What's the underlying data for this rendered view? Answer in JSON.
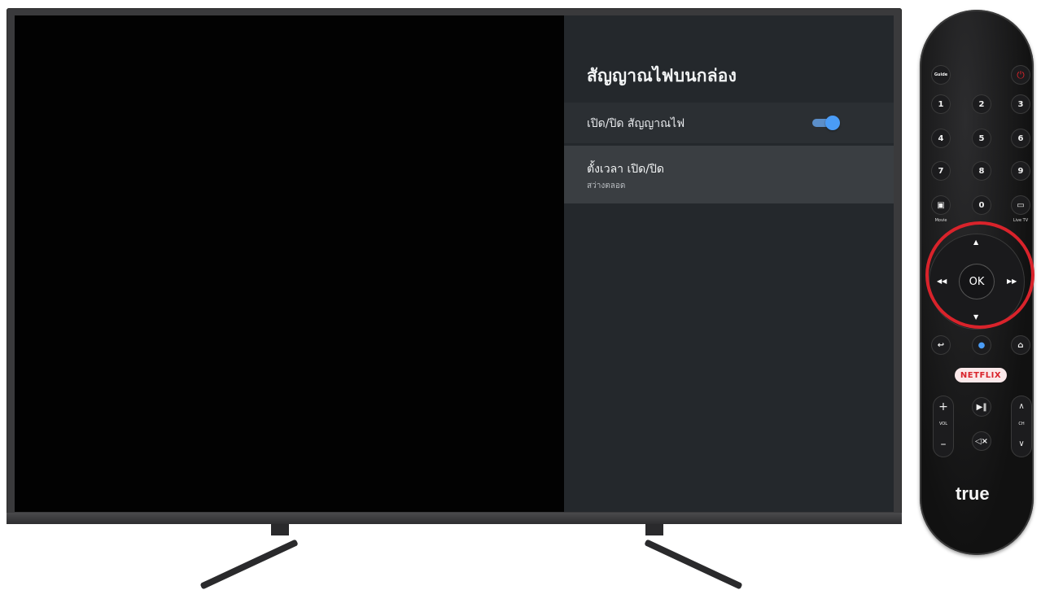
{
  "settings": {
    "title": "สัญญาณไฟบนกล่อง",
    "toggle_label": "เปิด/ปิด สัญญาณไฟ",
    "toggle_state": "on",
    "timer_label": "ตั้งเวลา เปิด/ปิด",
    "timer_value": "สว่างตลอด"
  },
  "remote": {
    "guide": "Guide",
    "digits": [
      "1",
      "2",
      "3",
      "4",
      "5",
      "6",
      "7",
      "8",
      "9",
      "0"
    ],
    "movie_label": "Movie",
    "livetv_label": "Live TV",
    "ok_label": "OK",
    "netflix_label": "NETFLIX",
    "vol_label": "VOL",
    "ch_label": "CH",
    "brand": "true"
  },
  "colors": {
    "accent": "#4a9cf6",
    "highlight_ring": "#d9232b",
    "panel_bg": "#24282c"
  }
}
